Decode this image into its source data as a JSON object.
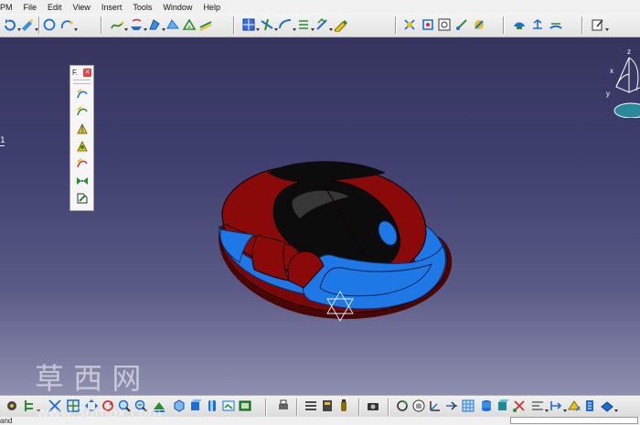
{
  "menu": {
    "items": [
      "PM",
      "File",
      "Edit",
      "View",
      "Insert",
      "Tools",
      "Window",
      "Help"
    ]
  },
  "viewport": {
    "tree_label": "1"
  },
  "float_panel": {
    "title": "F."
  },
  "compass": {
    "axis_x": "x",
    "axis_y": "y",
    "axis_z": "z"
  },
  "statusbar": {
    "text": "and"
  },
  "watermark": {
    "chinese": "草 西 网",
    "url": "www.3dmox.com"
  },
  "colors": {
    "model_red": "#8a0a0a",
    "model_blue": "#1e78e6",
    "model_black": "#0c0c0c",
    "background_top": "#36355f",
    "background_bottom": "#8f8fb0"
  }
}
